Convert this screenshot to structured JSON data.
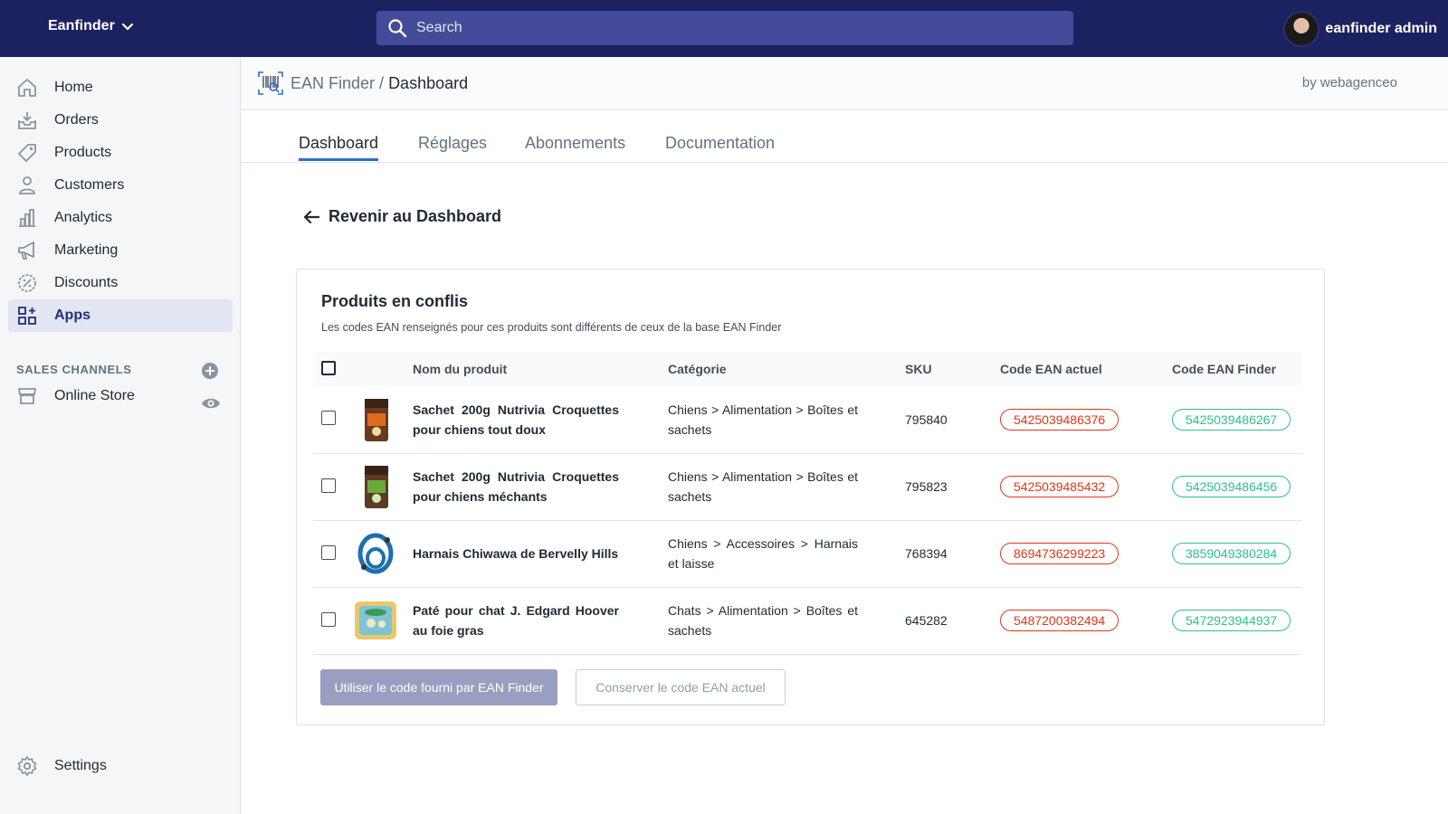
{
  "topbar": {
    "store_name": "Eanfinder",
    "search_placeholder": "Search",
    "user_name": "eanfinder admin"
  },
  "sidebar": {
    "items": [
      {
        "label": "Home",
        "icon": "home-icon"
      },
      {
        "label": "Orders",
        "icon": "orders-icon"
      },
      {
        "label": "Products",
        "icon": "tag-icon"
      },
      {
        "label": "Customers",
        "icon": "person-icon"
      },
      {
        "label": "Analytics",
        "icon": "bar-chart-icon"
      },
      {
        "label": "Marketing",
        "icon": "megaphone-icon"
      },
      {
        "label": "Discounts",
        "icon": "discount-icon"
      },
      {
        "label": "Apps",
        "icon": "apps-icon",
        "active": true
      }
    ],
    "sales_channels_label": "SALES CHANNELS",
    "online_store_label": "Online Store",
    "settings_label": "Settings"
  },
  "header": {
    "app_name": "EAN Finder",
    "separator": " / ",
    "page": "Dashboard",
    "by": "by webagenceo"
  },
  "tabs": [
    {
      "label": "Dashboard",
      "active": true
    },
    {
      "label": "Réglages"
    },
    {
      "label": "Abonnements"
    },
    {
      "label": "Documentation"
    }
  ],
  "back_link": "Revenir au Dashboard",
  "card": {
    "title": "Produits en conflis",
    "description": "Les codes EAN renseignés pour ces produits sont différents de ceux de la base EAN Finder",
    "columns": [
      "Nom du produit",
      "Catégorie",
      "SKU",
      "Code EAN actuel",
      "Code EAN Finder"
    ],
    "rows": [
      {
        "name": "Sachet 200g Nutrivia Croquettes pour chiens tout doux",
        "category": "Chiens > Alimentation > Boîtes et sachets",
        "sku": "795840",
        "ean_current": "5425039486376",
        "ean_finder": "5425039486267",
        "thumb": "kibble-bag-orange"
      },
      {
        "name": "Sachet 200g Nutrivia Croquettes pour chiens méchants",
        "category": "Chiens > Alimentation > Boîtes et sachets",
        "sku": "795823",
        "ean_current": "5425039485432",
        "ean_finder": "5425039486456",
        "thumb": "kibble-bag-green"
      },
      {
        "name": "Harnais Chiwawa de Bervelly Hills",
        "category": "Chiens > Accessoires > Harnais et laisse",
        "sku": "768394",
        "ean_current": "8694736299223",
        "ean_finder": "3859049380284",
        "thumb": "harness"
      },
      {
        "name": "Paté pour chat J. Edgard Hoover au foie gras",
        "category": "Chats > Alimentation > Boîtes et sachets",
        "sku": "645282",
        "ean_current": "5487200382494",
        "ean_finder": "5472923944937",
        "thumb": "cat-food-tray"
      }
    ],
    "primary_button": "Utiliser le code fourni par EAN Finder",
    "secondary_button": "Conserver le code EAN actuel"
  },
  "colors": {
    "topbar": "#1c2260",
    "search": "#444c99",
    "accent_tab": "#2c6ecb",
    "ean_current": "#de3618",
    "ean_finder": "#2ec08e",
    "primary_button": "#9a9ec0"
  }
}
